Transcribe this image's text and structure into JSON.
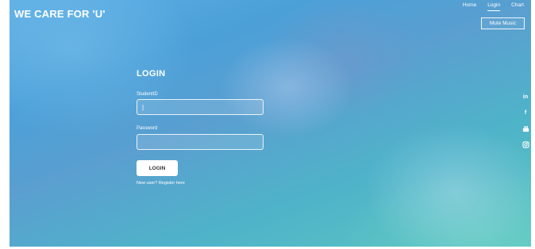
{
  "brand": {
    "title": "WE CARE FOR 'U'"
  },
  "nav": {
    "home": "Home",
    "login": "Login",
    "chart": "Chart"
  },
  "mute_button": {
    "label": "Mute Music"
  },
  "login_form": {
    "title": "LOGIN",
    "student_id_label": "StudentID",
    "student_id_value": "|",
    "password_label": "Password",
    "password_value": "",
    "submit_label": "LOGIN",
    "register_text": "New user? Register here"
  },
  "social": {
    "icons": [
      "linkedin-icon",
      "facebook-icon",
      "youtube-icon",
      "instagram-icon"
    ],
    "linkedin_glyph": "in",
    "facebook_glyph": "f"
  },
  "colors": {
    "background_start": "#5fb0e6",
    "background_end": "#5cc6c1",
    "text": "#ffffff"
  }
}
